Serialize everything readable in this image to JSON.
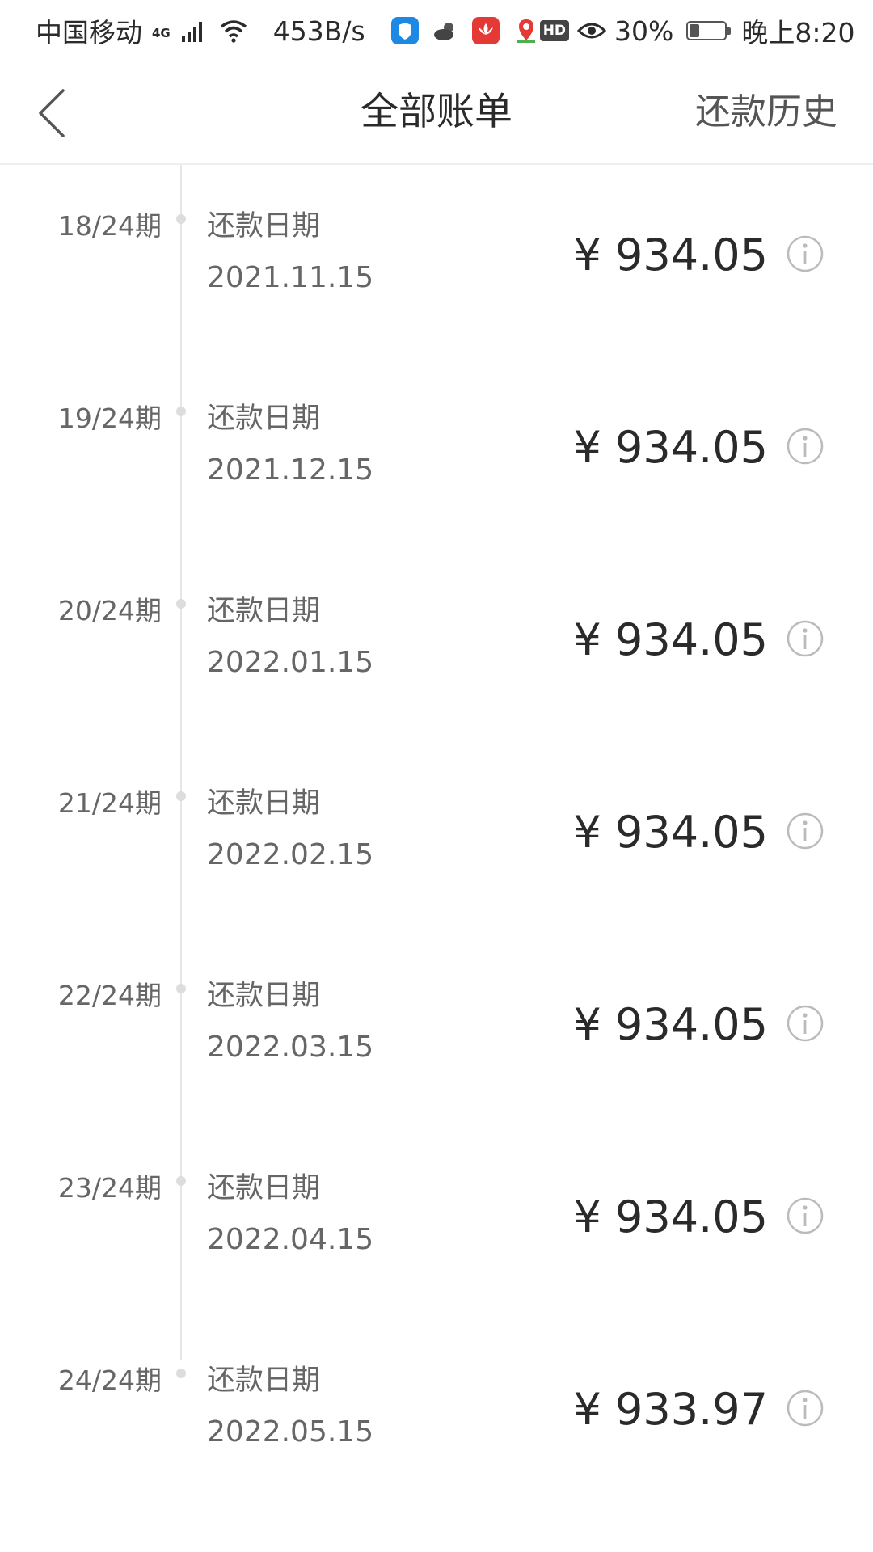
{
  "status_bar": {
    "carrier": "中国移动",
    "network_type": "4G",
    "net_speed": "453B/s",
    "hd_badge": "HD",
    "battery_percent": "30%",
    "battery_level": 0.3,
    "time": "晚上8:20",
    "app_icons": [
      "shield-app-icon",
      "weather-icon",
      "huawei-app-icon",
      "du-map-icon"
    ]
  },
  "header": {
    "title": "全部账单",
    "history_label": "还款历史",
    "back_icon": "chevron-left-icon"
  },
  "colors": {
    "text_primary": "#2a2a2a",
    "text_secondary": "#666666",
    "timeline": "#e6e6e6",
    "icon_gray": "#bbbbbb"
  },
  "bills": [
    {
      "period": "18/24期",
      "date_label": "还款日期",
      "date": "2021.11.15",
      "amount": "¥ 934.05"
    },
    {
      "period": "19/24期",
      "date_label": "还款日期",
      "date": "2021.12.15",
      "amount": "¥ 934.05"
    },
    {
      "period": "20/24期",
      "date_label": "还款日期",
      "date": "2022.01.15",
      "amount": "¥ 934.05"
    },
    {
      "period": "21/24期",
      "date_label": "还款日期",
      "date": "2022.02.15",
      "amount": "¥ 934.05"
    },
    {
      "period": "22/24期",
      "date_label": "还款日期",
      "date": "2022.03.15",
      "amount": "¥ 934.05"
    },
    {
      "period": "23/24期",
      "date_label": "还款日期",
      "date": "2022.04.15",
      "amount": "¥ 934.05"
    },
    {
      "period": "24/24期",
      "date_label": "还款日期",
      "date": "2022.05.15",
      "amount": "¥ 933.97"
    }
  ]
}
